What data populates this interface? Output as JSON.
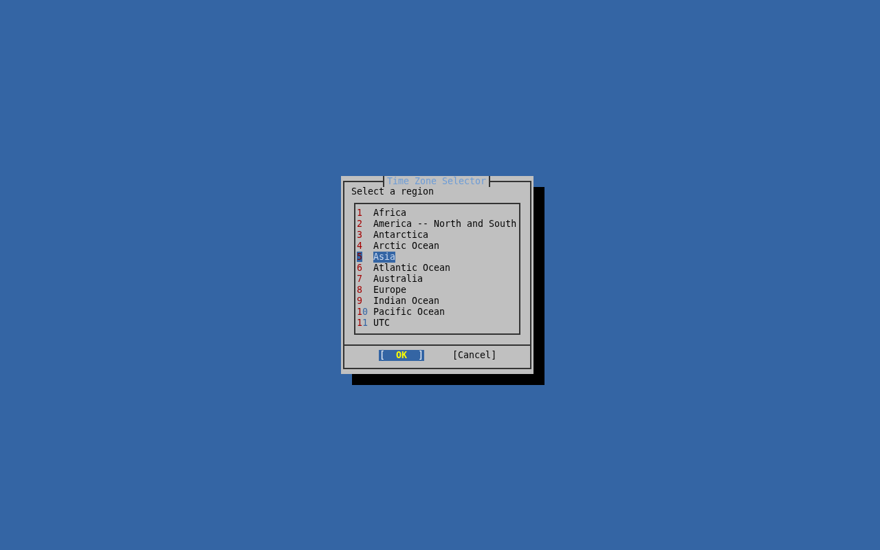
{
  "dialog": {
    "title": "Time Zone Selector",
    "prompt": "Select a region",
    "items": [
      {
        "tag": "1",
        "label": "Africa",
        "selected": false
      },
      {
        "tag": "2",
        "label": "America -- North and South",
        "selected": false
      },
      {
        "tag": "3",
        "label": "Antarctica",
        "selected": false
      },
      {
        "tag": "4",
        "label": "Arctic Ocean",
        "selected": false
      },
      {
        "tag": "5",
        "label": "Asia",
        "selected": true
      },
      {
        "tag": "6",
        "label": "Atlantic Ocean",
        "selected": false
      },
      {
        "tag": "7",
        "label": "Australia",
        "selected": false
      },
      {
        "tag": "8",
        "label": "Europe",
        "selected": false
      },
      {
        "tag": "9",
        "label": "Indian Ocean",
        "selected": false
      },
      {
        "tag": "10",
        "label": "Pacific Ocean",
        "selected": false
      },
      {
        "tag": "11",
        "label": "UTC",
        "selected": false
      }
    ],
    "buttons": [
      {
        "label": "[  OK  ]",
        "selected": true
      },
      {
        "label": "[Cancel]",
        "selected": false
      }
    ]
  }
}
